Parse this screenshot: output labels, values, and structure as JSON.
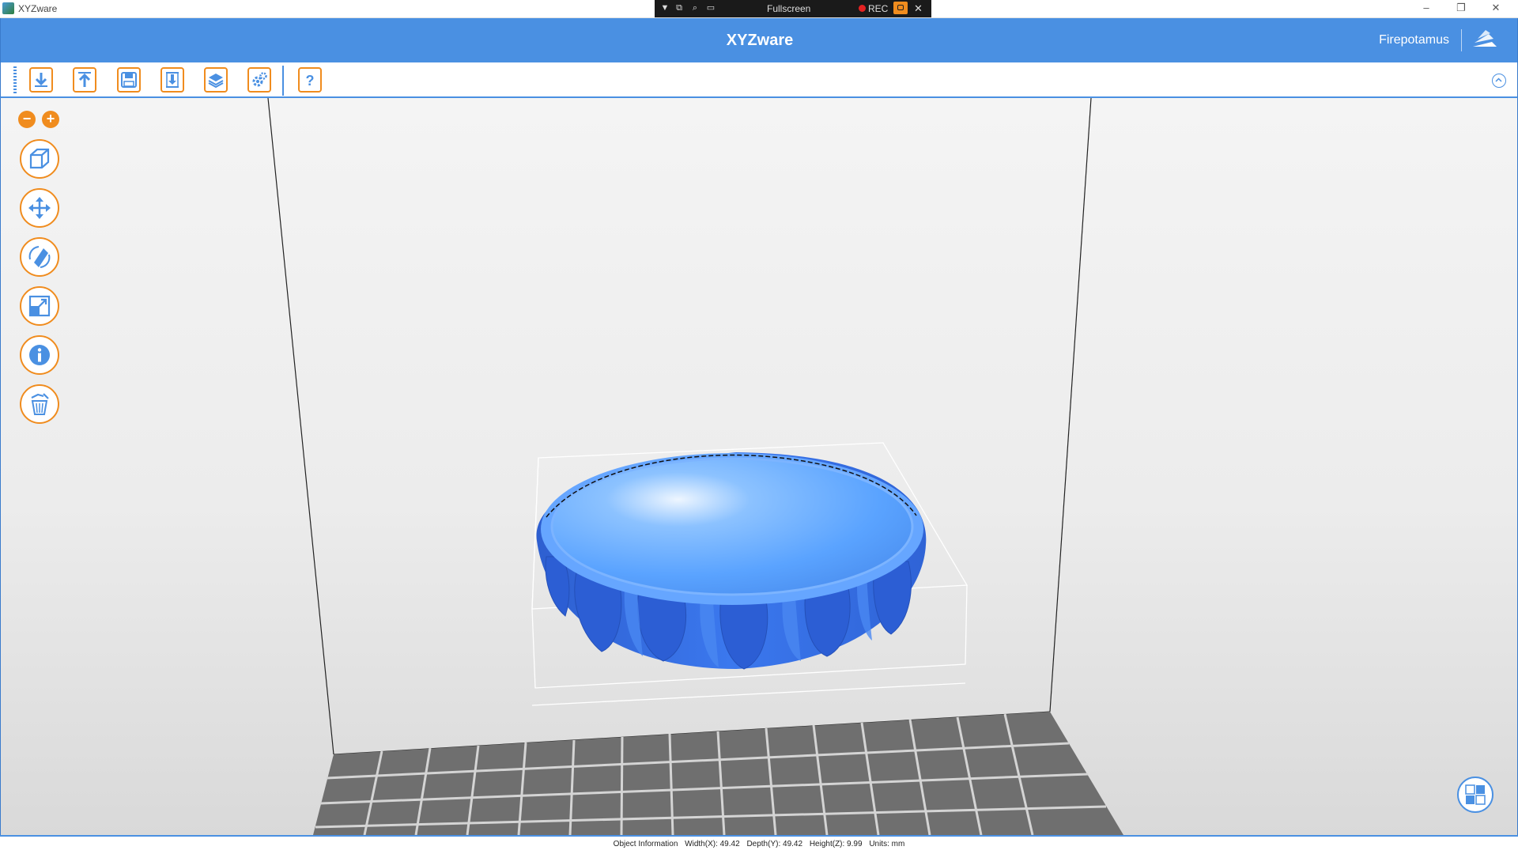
{
  "window": {
    "title": "XYZware",
    "controls": {
      "minimize": "–",
      "restore": "❐",
      "close": "✕"
    }
  },
  "recorder": {
    "mode": "Fullscreen",
    "rec": "REC",
    "close": "✕"
  },
  "header": {
    "title": "XYZware",
    "user": "Firepotamus"
  },
  "toolbar": {
    "buttons": [
      "import",
      "export",
      "save",
      "print",
      "layers",
      "settings",
      "help"
    ]
  },
  "zoom": {
    "out": "−",
    "in": "+"
  },
  "tools": [
    "view",
    "move",
    "rotate",
    "scale",
    "info",
    "delete"
  ],
  "status": {
    "label": "Object Information",
    "width": "Width(X): 49.42",
    "depth": "Depth(Y): 49.42",
    "height": "Height(Z): 9.99",
    "units": "Units: mm"
  },
  "colors": {
    "brand_blue": "#4a90e2",
    "accent_orange": "#f08c1e",
    "model_blue": "#3c7df0"
  }
}
